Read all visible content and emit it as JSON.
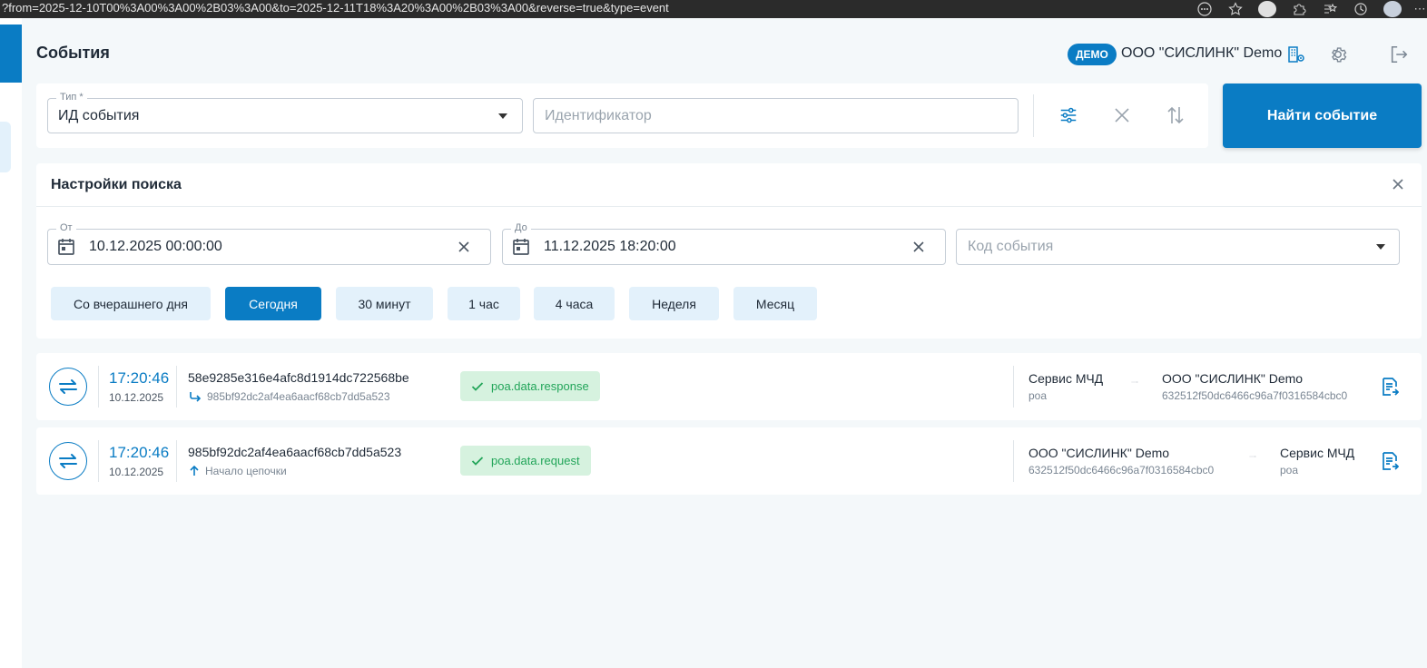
{
  "browser": {
    "url": "?from=2025-12-10T00%3A00%3A00%2B03%3A00&to=2025-12-11T18%3A20%3A00%2B03%3A00&reverse=true&type=event"
  },
  "header": {
    "title": "События",
    "demo_badge": "ДЕМО",
    "org_name": "ООО \"СИСЛИНК\" Demo"
  },
  "search": {
    "type_label": "Тип *",
    "type_value": "ИД события",
    "id_placeholder": "Идентификатор",
    "find_button": "Найти событие"
  },
  "settings": {
    "title": "Настройки поиска",
    "from_label": "От",
    "from_value": "10.12.2025 00:00:00",
    "to_label": "До",
    "to_value": "11.12.2025 18:20:00",
    "event_code_placeholder": "Код события",
    "chips": [
      "Со вчерашнего дня",
      "Сегодня",
      "30 минут",
      "1 час",
      "4 часа",
      "Неделя",
      "Месяц"
    ],
    "active_chip": "Сегодня"
  },
  "events": [
    {
      "time": "17:20:46",
      "date": "10.12.2025",
      "id": "58e9285e316e4afc8d1914dc722568be",
      "sub": "985bf92dc2af4ea6aacf68cb7dd5a523",
      "tag": "poa.data.response",
      "from_name": "Сервис МЧД",
      "from_sub": "poa",
      "to_name": "ООО \"СИСЛИНК\" Demo",
      "to_sub": "632512f50dc6466c96a7f0316584cbc0"
    },
    {
      "time": "17:20:46",
      "date": "10.12.2025",
      "id": "985bf92dc2af4ea6aacf68cb7dd5a523",
      "sub": "Начало цепочки",
      "tag": "poa.data.request",
      "from_name": "ООО \"СИСЛИНК\" Demo",
      "from_sub": "632512f50dc6466c96a7f0316584cbc0",
      "to_name": "Сервис МЧД",
      "to_sub": "poa"
    }
  ],
  "colors": {
    "accent": "#0a7cc4",
    "chip_bg": "#e3f1fb",
    "tag_bg": "#d6f2df",
    "tag_text": "#22a559",
    "page_bg": "#f4f8fa"
  }
}
